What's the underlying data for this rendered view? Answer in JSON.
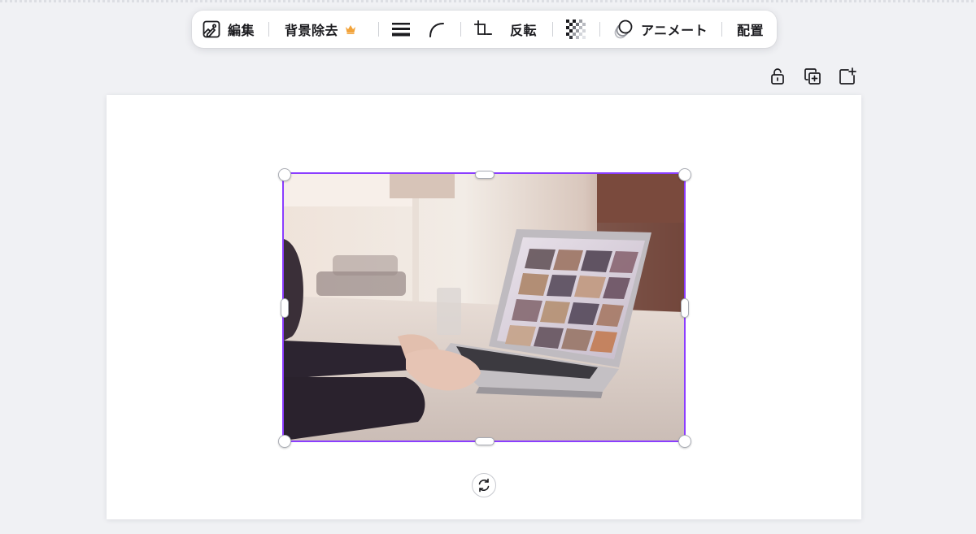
{
  "toolbar": {
    "edit_label": "編集",
    "bg_remove_label": "背景除去",
    "flip_label": "反転",
    "animate_label": "アニメート",
    "position_label": "配置",
    "crown_color": "#f2a33a"
  },
  "side_actions": [
    "lock-icon",
    "duplicate-icon",
    "add-page-icon"
  ],
  "selection": {
    "accent": "#8b3dff"
  },
  "image": {
    "subject": "laptop-photo"
  }
}
